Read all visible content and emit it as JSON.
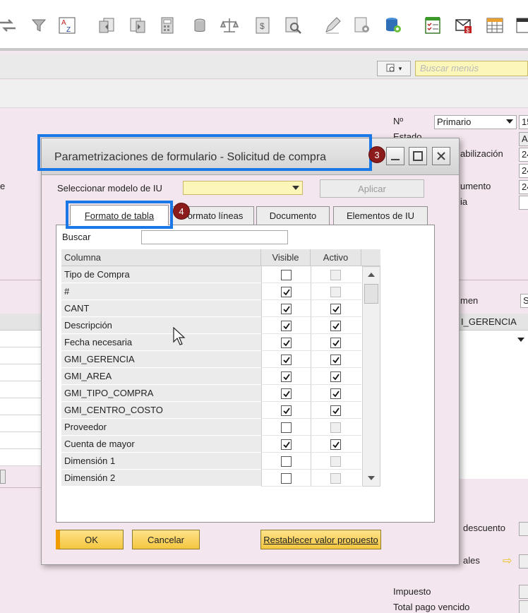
{
  "toolbar": {
    "icons": [
      "transfer-icon",
      "filter-icon",
      "sort-az-icon",
      "copy-from-icon",
      "copy-to-icon",
      "calculator-icon",
      "bin-icon",
      "balance-icon",
      "price-list-icon",
      "inspect-icon",
      "edit-icon",
      "settings-doc-icon",
      "database-gear-icon",
      "checklist-icon",
      "mail-export-icon",
      "spreadsheet-icon",
      "window-icon"
    ]
  },
  "menu_search": {
    "placeholder": "Buscar menús"
  },
  "background_form": {
    "right_labels": [
      "Nº",
      "Estado",
      "abilización",
      "umento",
      "ia",
      "men",
      "descuento",
      "ales",
      "Impuesto",
      "Total pago vencido"
    ],
    "numbering_series": "Primario",
    "field_fragments": [
      "15",
      "A",
      "24",
      "24",
      "24",
      "S"
    ],
    "grid_column_fragment": "I_GERENCIA",
    "left_fragment": "e"
  },
  "dialog": {
    "title": "Parametrizaciones de formulario - Solicitud de compra",
    "badge_title": "3",
    "badge_tab": "4",
    "model_label": "Seleccionar modelo de IU",
    "apply_label": "Aplicar",
    "tabs": [
      "Formato de tabla",
      "Formato líneas",
      "Documento",
      "Elementos de IU"
    ],
    "search_label": "Buscar",
    "columns": {
      "name": "Columna",
      "visible": "Visible",
      "active": "Activo"
    },
    "rows": [
      {
        "name": "Tipo de Compra",
        "visible": false,
        "active": false,
        "active_enabled": false
      },
      {
        "name": "#",
        "visible": true,
        "active": false,
        "active_enabled": false
      },
      {
        "name": "CANT",
        "visible": true,
        "active": true,
        "active_enabled": true
      },
      {
        "name": "Descripción",
        "visible": true,
        "active": true,
        "active_enabled": true
      },
      {
        "name": "Fecha necesaria",
        "visible": true,
        "active": true,
        "active_enabled": true
      },
      {
        "name": "GMI_GERENCIA",
        "visible": true,
        "active": true,
        "active_enabled": true
      },
      {
        "name": "GMI_AREA",
        "visible": true,
        "active": true,
        "active_enabled": true
      },
      {
        "name": "GMI_TIPO_COMPRA",
        "visible": true,
        "active": true,
        "active_enabled": true
      },
      {
        "name": "GMI_CENTRO_COSTO",
        "visible": true,
        "active": true,
        "active_enabled": true
      },
      {
        "name": "Proveedor",
        "visible": false,
        "active": false,
        "active_enabled": false
      },
      {
        "name": "Cuenta de mayor",
        "visible": true,
        "active": true,
        "active_enabled": true
      },
      {
        "name": "Dimensión 1",
        "visible": false,
        "active": false,
        "active_enabled": false
      },
      {
        "name": "Dimensión 2",
        "visible": false,
        "active": false,
        "active_enabled": false
      }
    ],
    "buttons": {
      "ok": "OK",
      "cancel": "Cancelar",
      "reset": "Restablecer valor propuesto"
    }
  },
  "colors": {
    "highlight": "#1a78e6",
    "badge": "#8c1b1b",
    "form_background": "#f4e6ee",
    "button_yellow": "#f4c63f",
    "search_yellow": "#fdf6b9"
  }
}
